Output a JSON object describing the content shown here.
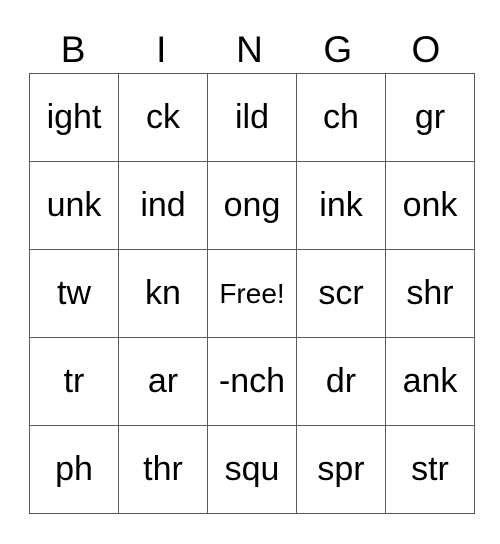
{
  "card": {
    "header": [
      "B",
      "I",
      "N",
      "G",
      "O"
    ],
    "rows": [
      [
        "ight",
        "ck",
        "ild",
        "ch",
        "gr"
      ],
      [
        "unk",
        "ind",
        "ong",
        "ink",
        "onk"
      ],
      [
        "tw",
        "kn",
        "Free!",
        "scr",
        "shr"
      ],
      [
        "tr",
        "ar",
        "-nch",
        "dr",
        "ank"
      ],
      [
        "ph",
        "thr",
        "squ",
        "spr",
        "str"
      ]
    ],
    "free_space": {
      "row": 2,
      "col": 2,
      "label": "Free!"
    }
  }
}
